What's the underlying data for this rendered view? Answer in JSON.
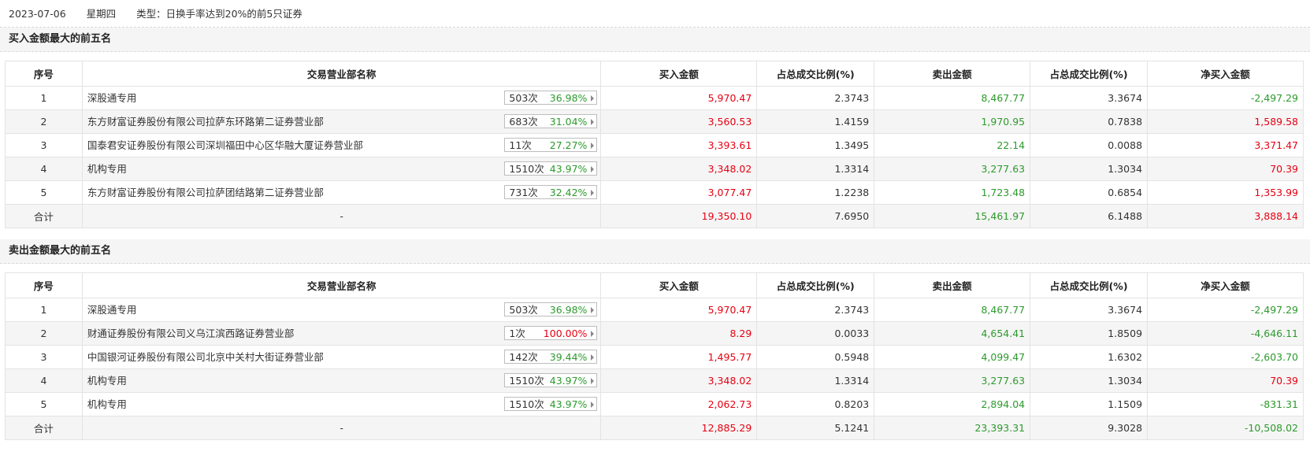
{
  "header": {
    "date": "2023-07-06",
    "weekday": "星期四",
    "type_label": "类型：日换手率达到20%的前5只证券"
  },
  "columns": {
    "seq": "序号",
    "name": "交易营业部名称",
    "buy": "买入金额",
    "buy_ratio": "占总成交比例(%)",
    "sell": "卖出金额",
    "sell_ratio": "占总成交比例(%)",
    "net": "净买入金额"
  },
  "buy_section": {
    "title": "买入金额最大的前五名",
    "rows": [
      {
        "seq": "1",
        "name": "深股通专用",
        "count": "503次",
        "pct": "36.98%",
        "pct_color": "green",
        "buy": "5,970.47",
        "buy_ratio": "2.3743",
        "sell": "8,467.77",
        "sell_ratio": "3.3674",
        "net": "-2,497.29",
        "net_color": "green"
      },
      {
        "seq": "2",
        "name": "东方财富证券股份有限公司拉萨东环路第二证券营业部",
        "count": "683次",
        "pct": "31.04%",
        "pct_color": "green",
        "buy": "3,560.53",
        "buy_ratio": "1.4159",
        "sell": "1,970.95",
        "sell_ratio": "0.7838",
        "net": "1,589.58",
        "net_color": "red"
      },
      {
        "seq": "3",
        "name": "国泰君安证券股份有限公司深圳福田中心区华融大厦证券营业部",
        "count": "11次",
        "pct": "27.27%",
        "pct_color": "green",
        "buy": "3,393.61",
        "buy_ratio": "1.3495",
        "sell": "22.14",
        "sell_ratio": "0.0088",
        "net": "3,371.47",
        "net_color": "red"
      },
      {
        "seq": "4",
        "name": "机构专用",
        "count": "1510次",
        "pct": "43.97%",
        "pct_color": "green",
        "buy": "3,348.02",
        "buy_ratio": "1.3314",
        "sell": "3,277.63",
        "sell_ratio": "1.3034",
        "net": "70.39",
        "net_color": "red"
      },
      {
        "seq": "5",
        "name": "东方财富证券股份有限公司拉萨团结路第二证券营业部",
        "count": "731次",
        "pct": "32.42%",
        "pct_color": "green",
        "buy": "3,077.47",
        "buy_ratio": "1.2238",
        "sell": "1,723.48",
        "sell_ratio": "0.6854",
        "net": "1,353.99",
        "net_color": "red"
      }
    ],
    "total": {
      "label": "合计",
      "name": "-",
      "buy": "19,350.10",
      "buy_ratio": "7.6950",
      "sell": "15,461.97",
      "sell_ratio": "6.1488",
      "net": "3,888.14",
      "net_color": "red"
    }
  },
  "sell_section": {
    "title": "卖出金额最大的前五名",
    "rows": [
      {
        "seq": "1",
        "name": "深股通专用",
        "count": "503次",
        "pct": "36.98%",
        "pct_color": "green",
        "buy": "5,970.47",
        "buy_ratio": "2.3743",
        "sell": "8,467.77",
        "sell_ratio": "3.3674",
        "net": "-2,497.29",
        "net_color": "green"
      },
      {
        "seq": "2",
        "name": "财通证券股份有限公司义乌江滨西路证券营业部",
        "count": "1次",
        "pct": "100.00%",
        "pct_color": "red",
        "buy": "8.29",
        "buy_ratio": "0.0033",
        "sell": "4,654.41",
        "sell_ratio": "1.8509",
        "net": "-4,646.11",
        "net_color": "green"
      },
      {
        "seq": "3",
        "name": "中国银河证券股份有限公司北京中关村大街证券营业部",
        "count": "142次",
        "pct": "39.44%",
        "pct_color": "green",
        "buy": "1,495.77",
        "buy_ratio": "0.5948",
        "sell": "4,099.47",
        "sell_ratio": "1.6302",
        "net": "-2,603.70",
        "net_color": "green"
      },
      {
        "seq": "4",
        "name": "机构专用",
        "count": "1510次",
        "pct": "43.97%",
        "pct_color": "green",
        "buy": "3,348.02",
        "buy_ratio": "1.3314",
        "sell": "3,277.63",
        "sell_ratio": "1.3034",
        "net": "70.39",
        "net_color": "red"
      },
      {
        "seq": "5",
        "name": "机构专用",
        "count": "1510次",
        "pct": "43.97%",
        "pct_color": "green",
        "buy": "2,062.73",
        "buy_ratio": "0.8203",
        "sell": "2,894.04",
        "sell_ratio": "1.1509",
        "net": "-831.31",
        "net_color": "green"
      }
    ],
    "total": {
      "label": "合计",
      "name": "-",
      "buy": "12,885.29",
      "buy_ratio": "5.1241",
      "sell": "23,393.31",
      "sell_ratio": "9.3028",
      "net": "-10,508.02",
      "net_color": "green"
    }
  },
  "colors": {
    "red": "#e60012",
    "green": "#2d9a2d",
    "alt_row": "#f5f5f5"
  },
  "icons": {
    "row_arrow": "triangle-right-icon"
  }
}
